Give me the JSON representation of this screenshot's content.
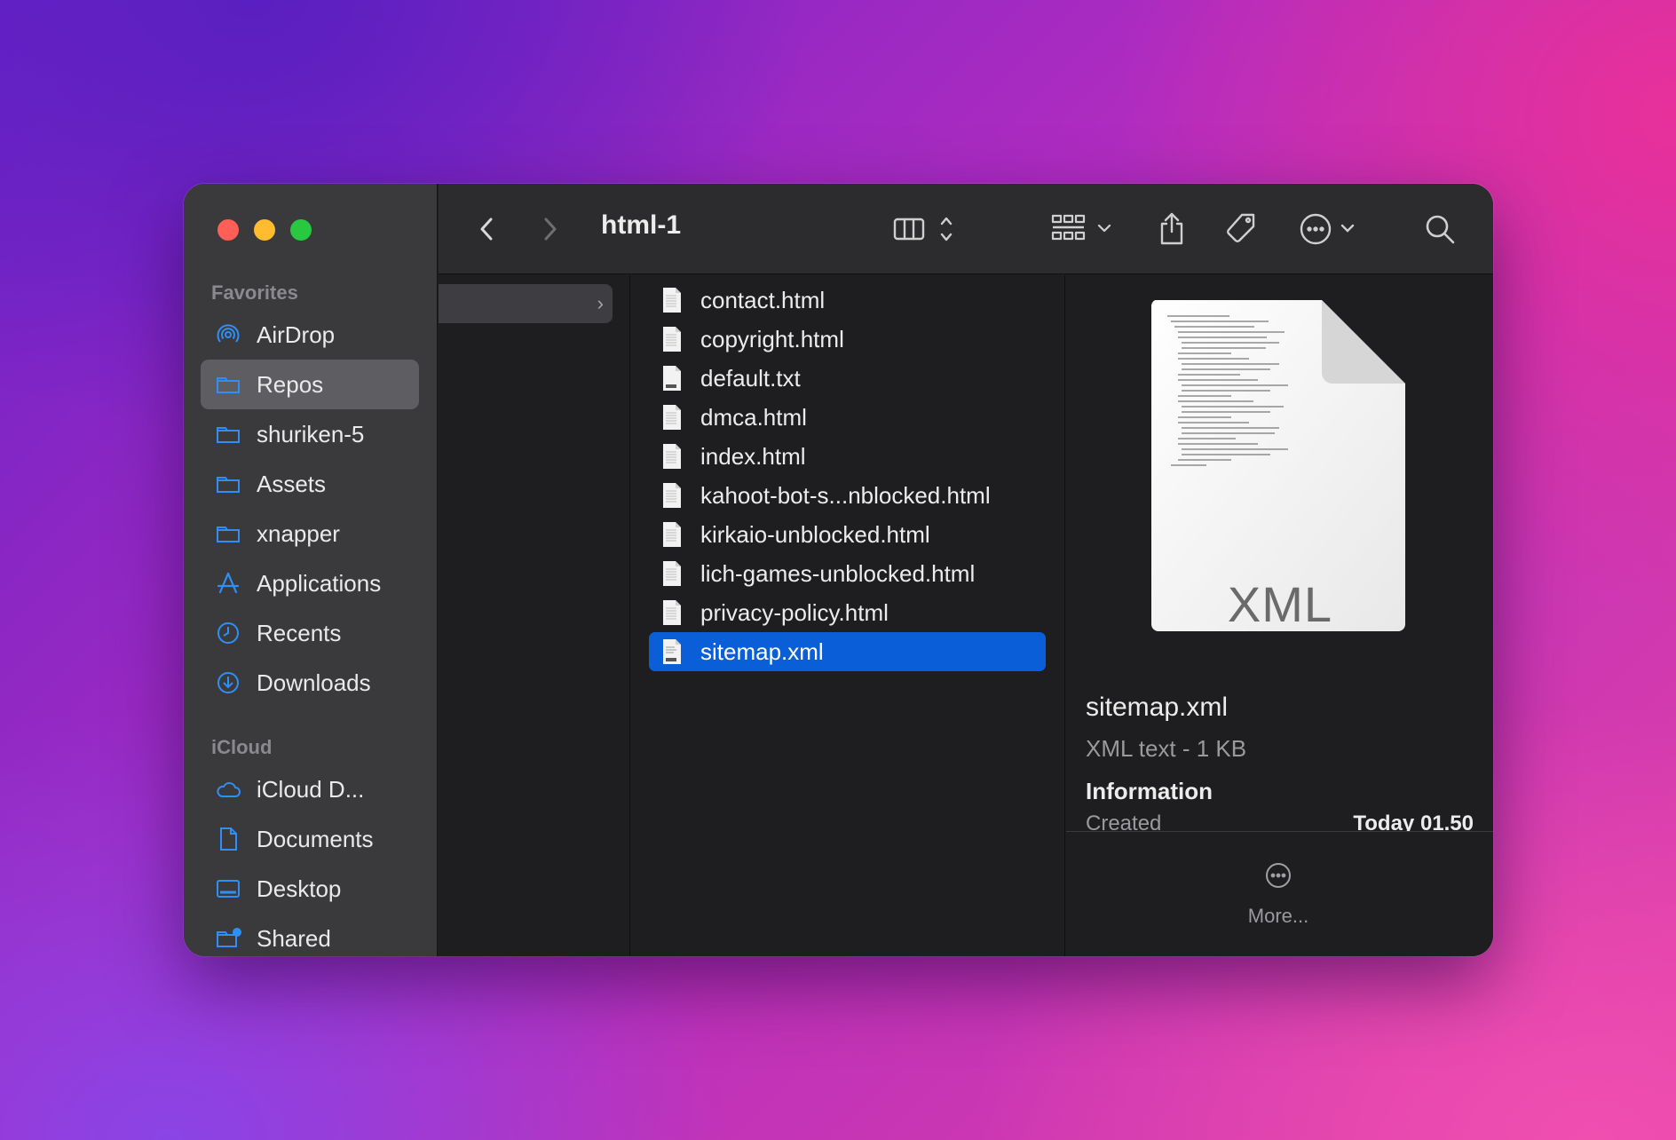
{
  "window": {
    "title": "html-1"
  },
  "sidebar": {
    "favorites_label": "Favorites",
    "icloud_label": "iCloud",
    "favorites": [
      {
        "label": "AirDrop",
        "icon": "airdrop-icon"
      },
      {
        "label": "Repos",
        "icon": "folder-icon",
        "active": true
      },
      {
        "label": "shuriken-5",
        "icon": "folder-icon"
      },
      {
        "label": "Assets",
        "icon": "folder-icon"
      },
      {
        "label": "xnapper",
        "icon": "folder-icon"
      },
      {
        "label": "Applications",
        "icon": "applications-icon"
      },
      {
        "label": "Recents",
        "icon": "clock-icon"
      },
      {
        "label": "Downloads",
        "icon": "download-icon"
      }
    ],
    "icloud": [
      {
        "label": "iCloud D...",
        "icon": "cloud-icon"
      },
      {
        "label": "Documents",
        "icon": "document-icon"
      },
      {
        "label": "Desktop",
        "icon": "desktop-icon"
      },
      {
        "label": "Shared",
        "icon": "shared-folder-icon"
      }
    ]
  },
  "toolbar": {
    "back": "back-chevron-icon",
    "forward": "forward-chevron-icon",
    "view": "column-view-icon",
    "group": "grid-group-icon",
    "share": "share-icon",
    "tag": "tag-icon",
    "action": "more-actions-icon",
    "search": "search-icon"
  },
  "files": [
    {
      "name": "contact.html",
      "type": "html"
    },
    {
      "name": "copyright.html",
      "type": "html"
    },
    {
      "name": "default.txt",
      "type": "txt"
    },
    {
      "name": "dmca.html",
      "type": "html"
    },
    {
      "name": "index.html",
      "type": "html"
    },
    {
      "name": "kahoot-bot-s...nblocked.html",
      "type": "html"
    },
    {
      "name": "kirkaio-unblocked.html",
      "type": "html"
    },
    {
      "name": "lich-games-unblocked.html",
      "type": "html"
    },
    {
      "name": "privacy-policy.html",
      "type": "html"
    },
    {
      "name": "sitemap.xml",
      "type": "xml",
      "selected": true
    }
  ],
  "preview": {
    "badge": "XML",
    "name": "sitemap.xml",
    "kind": "XML text - 1 KB",
    "info_heading": "Information",
    "created_label": "Created",
    "created_value": "Today 01.50",
    "more_label": "More..."
  },
  "colors": {
    "selection": "#0a5fd8",
    "accent": "#2f8ff5"
  }
}
